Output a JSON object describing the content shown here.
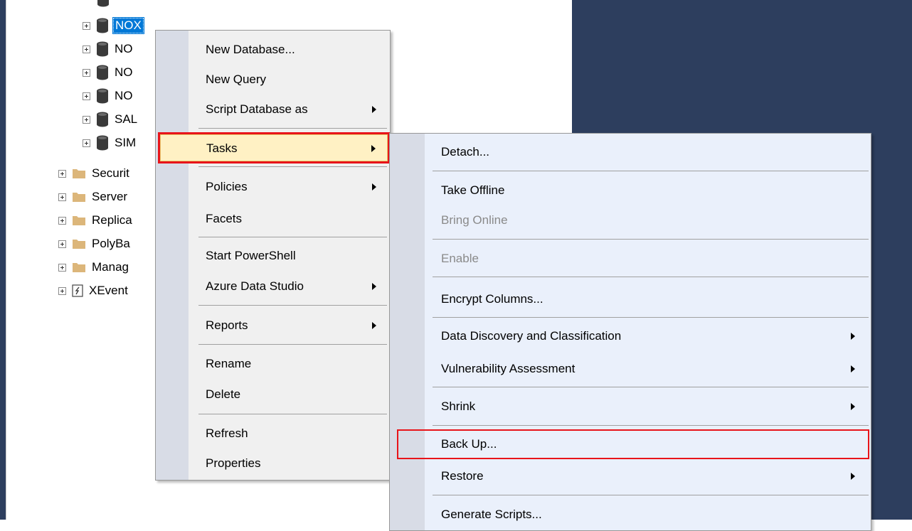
{
  "tree": {
    "databases": [
      {
        "label": "NOX",
        "selected": true
      },
      {
        "label": "NO",
        "selected": false
      },
      {
        "label": "NO",
        "selected": false
      },
      {
        "label": "NO",
        "selected": false
      },
      {
        "label": "SAL",
        "selected": false
      },
      {
        "label": "SIM",
        "selected": false
      }
    ],
    "folders": [
      {
        "label": "Securit",
        "icon": "folder-icon"
      },
      {
        "label": "Server",
        "icon": "folder-icon"
      },
      {
        "label": "Replica",
        "icon": "folder-icon"
      },
      {
        "label": "PolyBa",
        "icon": "folder-icon"
      },
      {
        "label": "Manag",
        "icon": "folder-icon"
      },
      {
        "label": "XEvent",
        "icon": "xevent-icon"
      }
    ]
  },
  "context_menu": {
    "items": [
      {
        "label": "New Database...",
        "has_submenu": false
      },
      {
        "label": "New Query",
        "has_submenu": false
      },
      {
        "label": "Script Database as",
        "has_submenu": true
      },
      {
        "label": "Tasks",
        "has_submenu": true,
        "highlighted": true
      },
      {
        "label": "Policies",
        "has_submenu": true
      },
      {
        "label": "Facets",
        "has_submenu": false
      },
      {
        "label": "Start PowerShell",
        "has_submenu": false
      },
      {
        "label": "Azure Data Studio",
        "has_submenu": true
      },
      {
        "label": "Reports",
        "has_submenu": true
      },
      {
        "label": "Rename",
        "has_submenu": false
      },
      {
        "label": "Delete",
        "has_submenu": false
      },
      {
        "label": "Refresh",
        "has_submenu": false
      },
      {
        "label": "Properties",
        "has_submenu": false
      }
    ]
  },
  "tasks_submenu": {
    "items": [
      {
        "label": "Detach...",
        "enabled": true,
        "has_submenu": false
      },
      {
        "label": "Take Offline",
        "enabled": true,
        "has_submenu": false
      },
      {
        "label": "Bring Online",
        "enabled": false,
        "has_submenu": false
      },
      {
        "label": "Enable",
        "enabled": false,
        "has_submenu": false
      },
      {
        "label": "Encrypt Columns...",
        "enabled": true,
        "has_submenu": false
      },
      {
        "label": "Data Discovery and Classification",
        "enabled": true,
        "has_submenu": true
      },
      {
        "label": "Vulnerability Assessment",
        "enabled": true,
        "has_submenu": true
      },
      {
        "label": "Shrink",
        "enabled": true,
        "has_submenu": true
      },
      {
        "label": "Back Up...",
        "enabled": true,
        "has_submenu": false,
        "annotated": true
      },
      {
        "label": "Restore",
        "enabled": true,
        "has_submenu": true
      },
      {
        "label": "Generate Scripts...",
        "enabled": true,
        "has_submenu": false
      }
    ]
  },
  "colors": {
    "background_panel": "#2d3e5e",
    "selection": "#0078d7",
    "menu_highlight": "#fff1c4",
    "annotation_red": "#e8141a",
    "submenu_bg": "#eaf0fb",
    "menu_bg": "#f0f0f0"
  }
}
